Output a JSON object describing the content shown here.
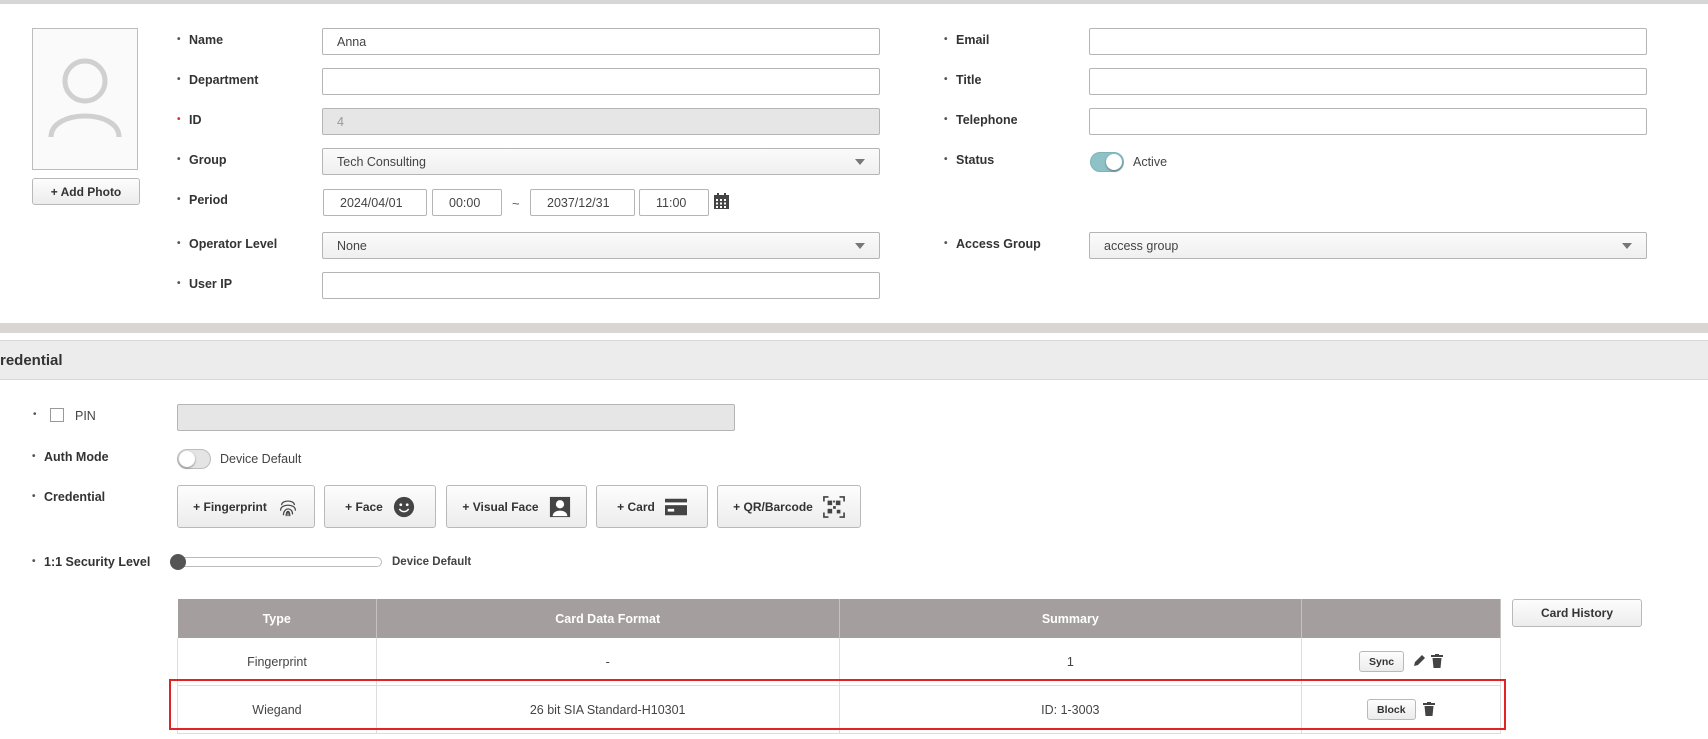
{
  "profile": {
    "add_photo_label": "+ Add Photo",
    "avatar_icon": "user-silhouette-icon"
  },
  "form": {
    "name": {
      "label": "Name",
      "value": "Anna"
    },
    "department": {
      "label": "Department",
      "value": ""
    },
    "id": {
      "label": "ID",
      "value": "4"
    },
    "group": {
      "label": "Group",
      "value": "Tech Consulting"
    },
    "period": {
      "label": "Period",
      "start_date": "2024/04/01",
      "start_time": "00:00",
      "separator": "~",
      "end_date": "2037/12/31",
      "end_time": "11:00"
    },
    "operator_level": {
      "label": "Operator Level",
      "value": "None"
    },
    "user_ip": {
      "label": "User IP",
      "value": ""
    },
    "email": {
      "label": "Email",
      "value": ""
    },
    "title": {
      "label": "Title",
      "value": ""
    },
    "telephone": {
      "label": "Telephone",
      "value": ""
    },
    "status": {
      "label": "Status",
      "value": "Active",
      "on": true
    },
    "access_group": {
      "label": "Access Group",
      "value": "access group"
    }
  },
  "credential_section": {
    "header": "redential",
    "pin": {
      "label": "PIN",
      "checked": false,
      "value": ""
    },
    "auth_mode": {
      "label": "Auth Mode",
      "value": "Device Default",
      "on": false
    },
    "credential_label": "Credential",
    "buttons": [
      {
        "label": "+ Fingerprint",
        "icon": "fingerprint-icon"
      },
      {
        "label": "+ Face",
        "icon": "face-icon"
      },
      {
        "label": "+ Visual Face",
        "icon": "visual-face-icon"
      },
      {
        "label": "+ Card",
        "icon": "card-icon"
      },
      {
        "label": "+ QR/Barcode",
        "icon": "qr-barcode-icon"
      }
    ],
    "security_level": {
      "label": "1:1 Security Level",
      "value": "Device Default"
    },
    "card_history_label": "Card History",
    "table": {
      "headers": [
        "Type",
        "Card Data Format",
        "Summary",
        ""
      ],
      "rows": [
        {
          "type": "Fingerprint",
          "format": "-",
          "summary": "1",
          "action": "Sync"
        },
        {
          "type": "Wiegand",
          "format": "26 bit SIA Standard-H10301",
          "summary": "ID: 1-3003",
          "action": "Block"
        }
      ]
    }
  },
  "colors": {
    "header_bg": "#a49e9e",
    "toggle_on": "#8fc2c7",
    "highlight": "#e02323"
  }
}
